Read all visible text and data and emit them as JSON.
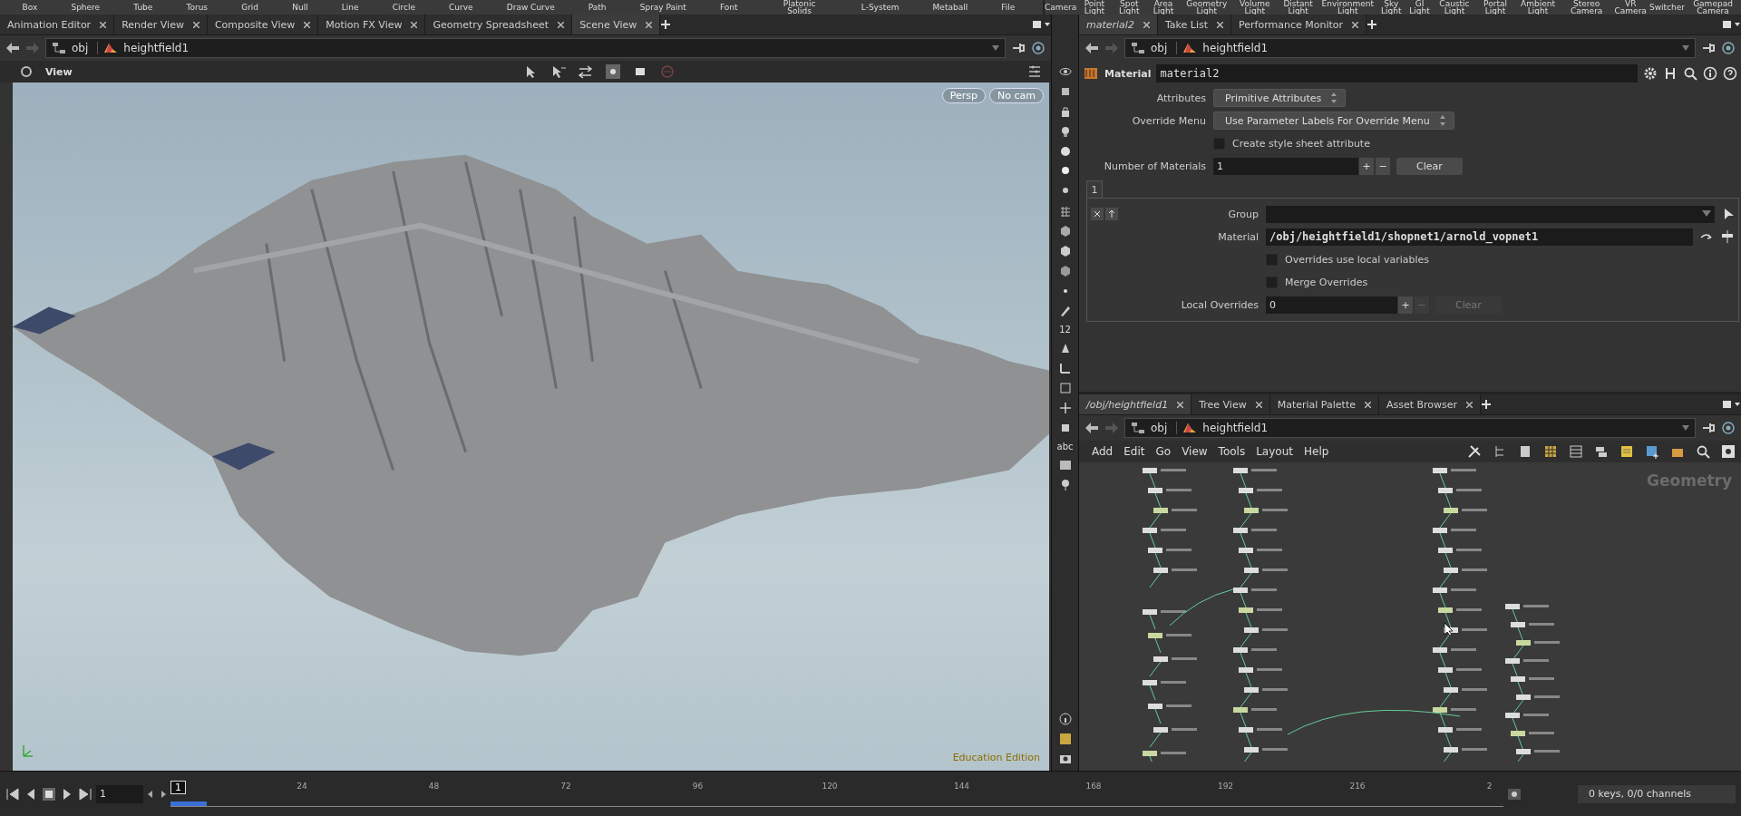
{
  "shelf": {
    "left": [
      "Box",
      "Sphere",
      "Tube",
      "Torus",
      "Grid",
      "Null",
      "Line",
      "Circle",
      "Curve",
      "Draw Curve",
      "Path",
      "Spray Paint",
      "Font",
      "Platonic Solids",
      "L-System",
      "Metaball",
      "File"
    ],
    "right": [
      "Camera",
      "Point Light",
      "Spot Light",
      "Area Light",
      "Geometry Light",
      "Volume Light",
      "Distant Light",
      "Environment Light",
      "Sky Light",
      "GI Light",
      "Caustic Light",
      "Portal Light",
      "Ambient Light",
      "Stereo Camera",
      "VR Camera",
      "Switcher",
      "Gamepad Camera"
    ]
  },
  "scene_pane": {
    "tabs": [
      {
        "label": "Animation Editor",
        "selected": false,
        "linked": false
      },
      {
        "label": "Render View",
        "selected": false,
        "linked": false
      },
      {
        "label": "Composite View",
        "selected": false,
        "linked": false
      },
      {
        "label": "Motion FX View",
        "selected": false,
        "linked": false
      },
      {
        "label": "Geometry Spreadsheet",
        "selected": false,
        "linked": false
      },
      {
        "label": "Scene View",
        "selected": true,
        "linked": false
      }
    ],
    "path": [
      "obj",
      "heightfield1"
    ],
    "viewport": {
      "title": "View",
      "camera_menu": "Persp",
      "cam_menu": "No cam",
      "edition_text": "Education Edition"
    },
    "side_toolbar": {
      "number_label": "12",
      "text_label": "abc"
    }
  },
  "param_pane": {
    "tabs": [
      {
        "label": "material2",
        "selected": true,
        "linked": true
      },
      {
        "label": "Take List",
        "selected": false,
        "linked": false
      },
      {
        "label": "Performance Monitor",
        "selected": false,
        "linked": false
      }
    ],
    "path": [
      "obj",
      "heightfield1"
    ],
    "node_type": "Material",
    "node_name": "material2",
    "params": [
      {
        "kind": "menu",
        "label": "Attributes",
        "value": "Primitive Attributes"
      },
      {
        "kind": "menu",
        "label": "Override Menu",
        "value": "Use Parameter Labels For Override Menu"
      },
      {
        "kind": "toggle",
        "label": "Create style sheet attribute",
        "checked": false
      },
      {
        "kind": "multi",
        "label": "Number of Materials",
        "value": "1",
        "plus": "+",
        "minus": "−",
        "clear": "Clear",
        "disabled": false
      }
    ],
    "folder_tab": "1",
    "block_params": [
      {
        "kind": "field",
        "label": "Group"
      },
      {
        "kind": "path",
        "label": "Material",
        "value": "/obj/heightfield1/shopnet1/arnold_vopnet1"
      },
      {
        "kind": "toggle",
        "label": "Overrides use local variables",
        "checked": false
      },
      {
        "kind": "toggle",
        "label": "Merge Overrides",
        "checked": false
      },
      {
        "kind": "multi",
        "label": "Local Overrides",
        "value": "0",
        "plus": "+",
        "minus": "−",
        "clear": "Clear",
        "disabled": true
      }
    ]
  },
  "network_pane": {
    "tabs": [
      {
        "label": "/obj/heightfield1",
        "selected": true,
        "linked": true
      },
      {
        "label": "Tree View",
        "selected": false,
        "linked": false
      },
      {
        "label": "Material Palette",
        "selected": false,
        "linked": false
      },
      {
        "label": "Asset Browser",
        "selected": false,
        "linked": false
      }
    ],
    "path": [
      "obj",
      "heightfield1"
    ],
    "menu": [
      "Add",
      "Edit",
      "Go",
      "View",
      "Tools",
      "Layout",
      "Help"
    ],
    "context_label": "Geometry"
  },
  "timeline": {
    "frame": "1",
    "start_marker": "1",
    "ticks": [
      "24",
      "48",
      "72",
      "96",
      "120",
      "144",
      "168",
      "192",
      "216",
      "2"
    ],
    "keys_status": "0 keys, 0/0 channels"
  }
}
